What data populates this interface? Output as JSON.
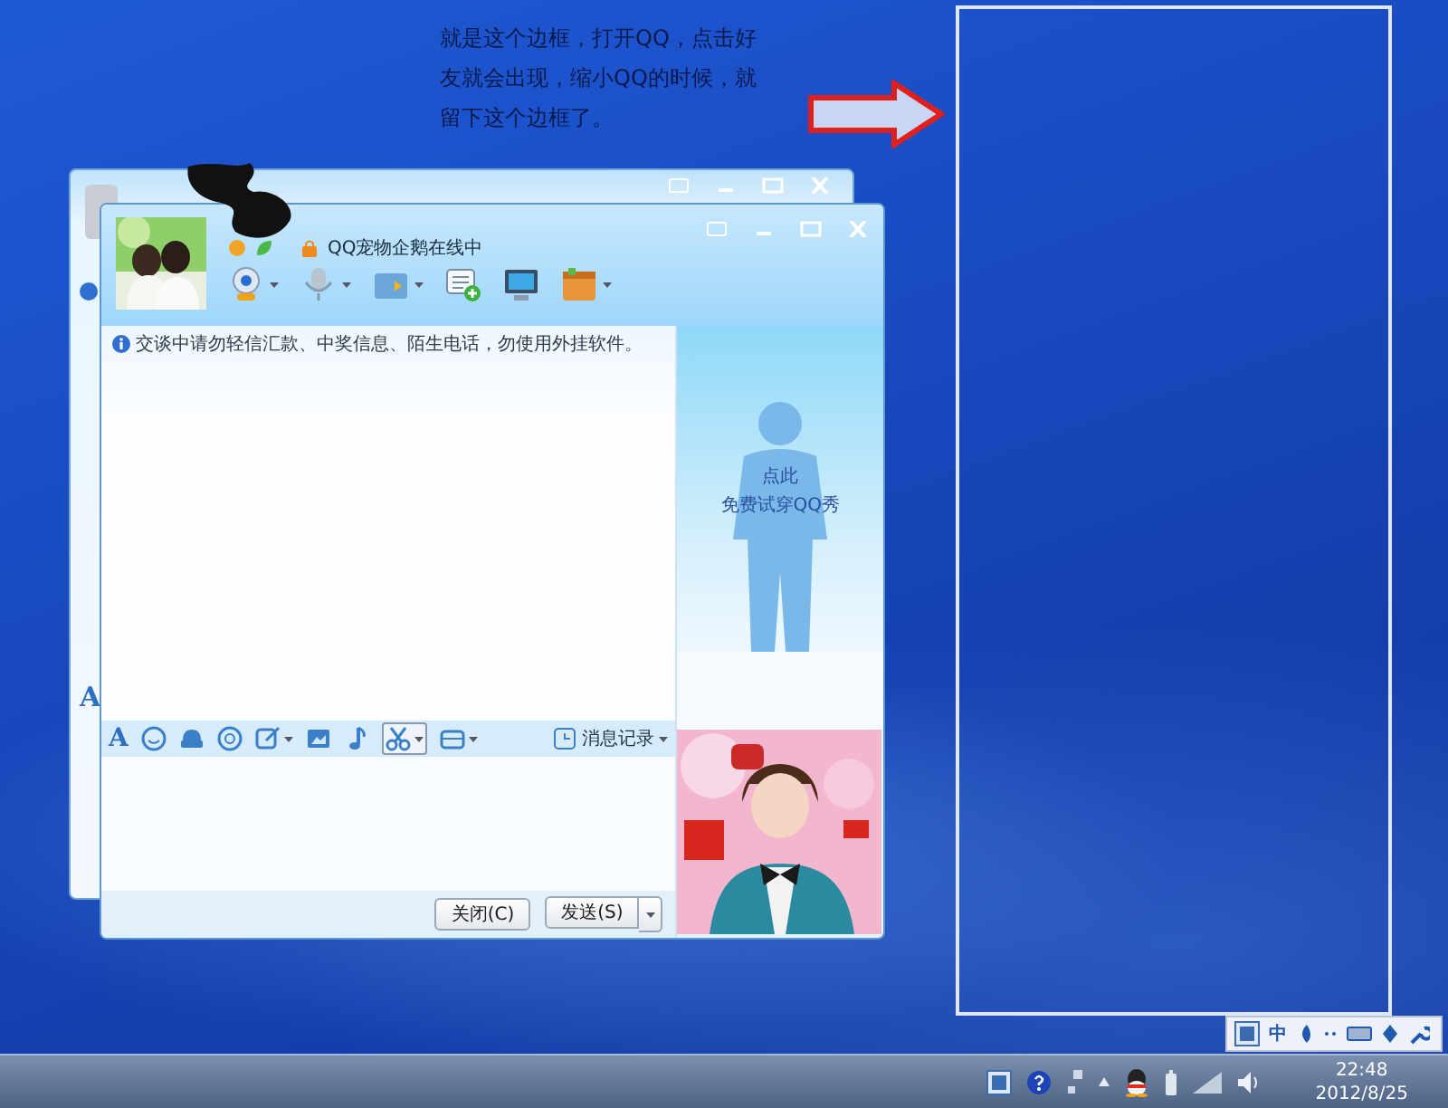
{
  "annotation": {
    "text": "就是这个边框，打开QQ，点击好友就会出现，缩小QQ的时候，就留下这个边框了。"
  },
  "back_window": {
    "font_label": "A"
  },
  "chat_window": {
    "status": "QQ宠物企鹅在线中",
    "notice": "交谈中请勿轻信汇款、中奖信息、陌生电话，勿使用外挂软件。",
    "show_prompt": [
      "点此",
      "免费试穿QQ秀"
    ],
    "font_label": "A",
    "history_button": "消息记录",
    "buttons": [
      {
        "kind": "plain",
        "label": "关闭(C)"
      },
      {
        "kind": "split",
        "label": "发送(S)"
      }
    ]
  },
  "ime_bar": {
    "mode": "中"
  },
  "taskbar": {
    "time": "22:48",
    "date": "2012/8/25"
  }
}
